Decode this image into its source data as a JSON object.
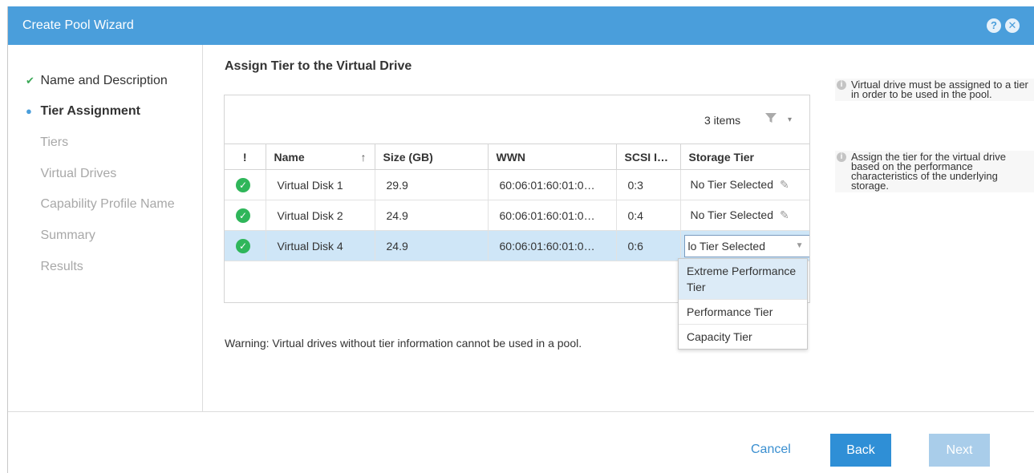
{
  "window": {
    "title": "Create Pool Wizard"
  },
  "icons": {
    "help": "help-icon",
    "close": "close-icon"
  },
  "steps": [
    {
      "label": "Name and Description",
      "state": "done",
      "mark": "✔"
    },
    {
      "label": "Tier Assignment",
      "state": "current",
      "mark": "●"
    },
    {
      "label": "Tiers",
      "state": "pending",
      "mark": ""
    },
    {
      "label": "Virtual Drives",
      "state": "pending",
      "mark": ""
    },
    {
      "label": "Capability Profile Name",
      "state": "pending",
      "mark": ""
    },
    {
      "label": "Summary",
      "state": "pending",
      "mark": ""
    },
    {
      "label": "Results",
      "state": "pending",
      "mark": ""
    }
  ],
  "main": {
    "heading": "Assign Tier to the Virtual Drive",
    "item_count": "3 items",
    "columns": [
      "!",
      "Name",
      "Size (GB)",
      "WWN",
      "SCSI I…",
      "Storage Tier"
    ],
    "rows": [
      {
        "name": "Virtual Disk 1",
        "size": "29.9",
        "wwn": "60:06:01:60:01:0…",
        "scsi": "0:3",
        "tier": "No Tier Selected"
      },
      {
        "name": "Virtual Disk 2",
        "size": "24.9",
        "wwn": "60:06:01:60:01:0…",
        "scsi": "0:4",
        "tier": "No Tier Selected"
      },
      {
        "name": "Virtual Disk 4",
        "size": "24.9",
        "wwn": "60:06:01:60:01:0…",
        "scsi": "0:6",
        "tier": "lo Tier Selected"
      }
    ],
    "dropdown_options": [
      "Extreme Performance Tier",
      "Performance Tier",
      "Capacity Tier"
    ],
    "warning": "Warning: Virtual drives without tier information cannot be used in a pool."
  },
  "info": [
    "Virtual drive must be assigned to a tier in order to be used in the pool.",
    "Assign the tier for the virtual drive based on the performance characteristics of the underlying storage."
  ],
  "footer": {
    "cancel": "Cancel",
    "back": "Back",
    "next": "Next"
  },
  "colors": {
    "titlebar": "#4a9edb",
    "primary_button": "#2f8fd6",
    "selected_row": "#cfe6f7",
    "ok": "#2fb65a"
  }
}
